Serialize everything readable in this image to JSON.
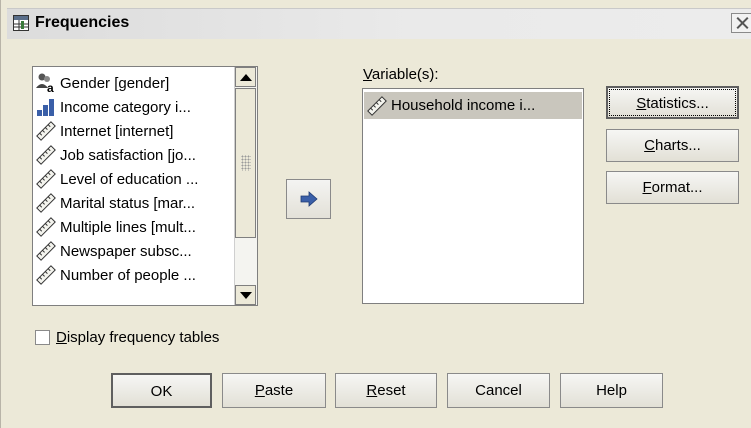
{
  "window": {
    "title": "Frequencies",
    "title_icon": "frequencies-table-icon",
    "close_icon": "close-icon"
  },
  "source_list": {
    "items": [
      {
        "label": "Gender [gender]",
        "icon": "nominal-icon"
      },
      {
        "label": "Income category i...",
        "icon": "ordinal-icon"
      },
      {
        "label": "Internet [internet]",
        "icon": "scale-icon"
      },
      {
        "label": "Job satisfaction [jo...",
        "icon": "scale-icon"
      },
      {
        "label": "Level of education ...",
        "icon": "scale-icon"
      },
      {
        "label": "Marital status [mar...",
        "icon": "scale-icon"
      },
      {
        "label": "Multiple lines [mult...",
        "icon": "scale-icon"
      },
      {
        "label": "Newspaper subsc...",
        "icon": "scale-icon"
      },
      {
        "label": "Number of people ...",
        "icon": "scale-icon"
      }
    ]
  },
  "move_button": {
    "icon": "move-right-arrow-icon"
  },
  "target": {
    "label_u": "V",
    "label_rest": "ariable(s):",
    "items": [
      {
        "label": "Household income i...",
        "icon": "scale-icon",
        "selected": true
      }
    ]
  },
  "side_buttons": {
    "statistics": {
      "u": "S",
      "rest": "tatistics..."
    },
    "charts": {
      "u": "C",
      "rest": "harts..."
    },
    "format": {
      "u": "F",
      "rest": "ormat..."
    }
  },
  "display_tables": {
    "u": "D",
    "rest": "isplay frequency tables",
    "checked": false
  },
  "bottom_buttons": {
    "ok": "OK",
    "paste": {
      "u": "P",
      "rest": "aste"
    },
    "reset": {
      "u": "R",
      "rest": "eset"
    },
    "cancel": "Cancel",
    "help": "Help"
  },
  "colors": {
    "dialog_bg": "#ece9d8",
    "selection_bg": "#c9c6bd",
    "arrow_blue": "#3a5fa8"
  }
}
